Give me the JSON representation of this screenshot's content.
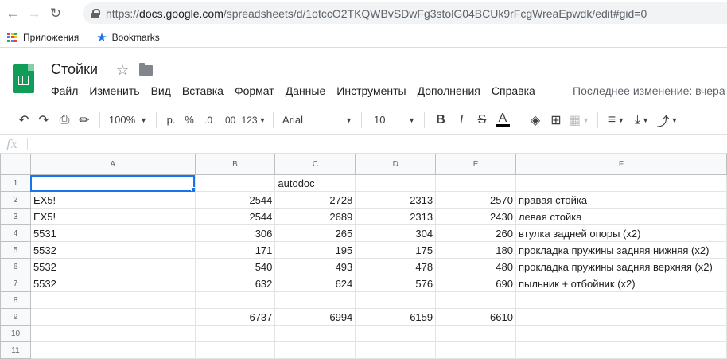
{
  "browser": {
    "url_host": "docs.google.com",
    "url_path": "/spreadsheets/d/1otccO2TKQWBvSDwFg3stolG04BCUk9rFcgWreaEpwdk/edit#gid=0",
    "url_prefix": "https://",
    "bookmarks": {
      "apps_label": "Приложения",
      "bookmarks_label": "Bookmarks"
    }
  },
  "doc": {
    "title": "Стойки"
  },
  "menu": [
    "Файл",
    "Изменить",
    "Вид",
    "Вставка",
    "Формат",
    "Данные",
    "Инструменты",
    "Дополнения",
    "Справка"
  ],
  "last_edit": "Последнее изменение: вчера",
  "toolbar": {
    "zoom": "100%",
    "currency": "р.",
    "percent": "%",
    "dec_minus": ".0",
    "dec_plus": ".00",
    "format_more": "123",
    "font": "Arial",
    "font_size": "10",
    "bold": "B",
    "italic": "I",
    "strike": "S",
    "text_color": "A",
    "text_color_value": "#000000"
  },
  "formula_bar": {
    "fx": "fx",
    "value": ""
  },
  "sheet": {
    "columns": [
      "A",
      "B",
      "C",
      "D",
      "E",
      "F"
    ],
    "rows": [
      {
        "n": "1",
        "a": "",
        "b": "",
        "c": "autodoc",
        "d": "",
        "e": "",
        "f": ""
      },
      {
        "n": "2",
        "a": "EX5!",
        "b": "2544",
        "c": "2728",
        "d": "2313",
        "e": "2570",
        "f": "правая стойка"
      },
      {
        "n": "3",
        "a": "EX5!",
        "b": "2544",
        "c": "2689",
        "d": "2313",
        "e": "2430",
        "f": "левая стойка"
      },
      {
        "n": "4",
        "a": "5531",
        "b": "306",
        "c": "265",
        "d": "304",
        "e": "260",
        "f": "втулка задней опоры (x2)"
      },
      {
        "n": "5",
        "a": "5532",
        "b": "171",
        "c": "195",
        "d": "175",
        "e": "180",
        "f": "прокладка пружины задняя нижняя (x2)"
      },
      {
        "n": "6",
        "a": "5532",
        "b": "540",
        "c": "493",
        "d": "478",
        "e": "480",
        "f": "прокладка пружины задняя верхняя (x2)"
      },
      {
        "n": "7",
        "a": "5532",
        "b": "632",
        "c": "624",
        "d": "576",
        "e": "690",
        "f": "пыльник + отбойник (x2)"
      },
      {
        "n": "8",
        "a": "",
        "b": "",
        "c": "",
        "d": "",
        "e": "",
        "f": ""
      },
      {
        "n": "9",
        "a": "",
        "b": "6737",
        "c": "6994",
        "d": "6159",
        "e": "6610",
        "f": ""
      },
      {
        "n": "10",
        "a": "",
        "b": "",
        "c": "",
        "d": "",
        "e": "",
        "f": ""
      },
      {
        "n": "11",
        "a": "",
        "b": "",
        "c": "",
        "d": "",
        "e": "",
        "f": ""
      }
    ]
  },
  "colors": {
    "sheets_green": "#0f9d58",
    "selection_blue": "#1a73e8",
    "bookmark_star": "#1a73e8"
  }
}
